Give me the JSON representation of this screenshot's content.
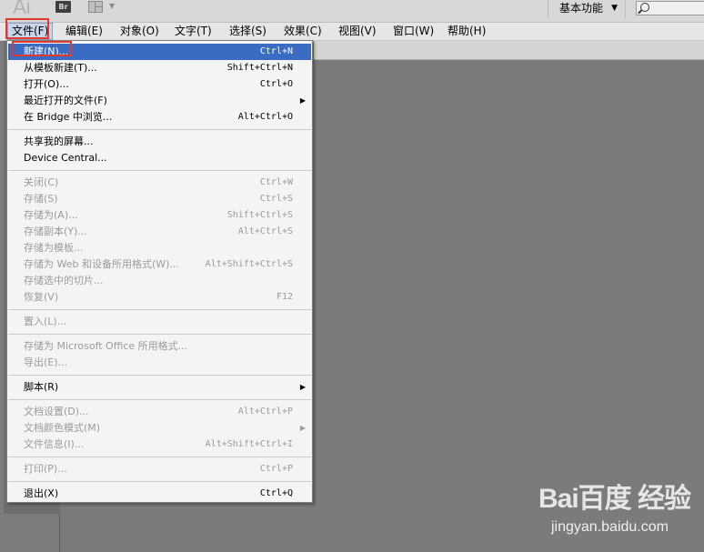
{
  "app": {
    "logo_text": "Ai",
    "bridge_badge": "Br",
    "workspace_label": "基本功能"
  },
  "menubar": [
    {
      "label": "文件(F)",
      "active": true
    },
    {
      "label": "编辑(E)"
    },
    {
      "label": "对象(O)"
    },
    {
      "label": "文字(T)"
    },
    {
      "label": "选择(S)"
    },
    {
      "label": "效果(C)"
    },
    {
      "label": "视图(V)"
    },
    {
      "label": "窗口(W)"
    },
    {
      "label": "帮助(H)"
    }
  ],
  "file_menu": [
    {
      "label": "新建(N)...",
      "shortcut": "Ctrl+N",
      "highlight": true
    },
    {
      "label": "从模板新建(T)...",
      "shortcut": "Shift+Ctrl+N"
    },
    {
      "label": "打开(O)...",
      "shortcut": "Ctrl+O"
    },
    {
      "label": "最近打开的文件(F)",
      "submenu": true
    },
    {
      "label": "在 Bridge 中浏览...",
      "shortcut": "Alt+Ctrl+O"
    },
    {
      "separator": true
    },
    {
      "label": "共享我的屏幕..."
    },
    {
      "label": "Device Central..."
    },
    {
      "separator": true
    },
    {
      "label": "关闭(C)",
      "shortcut": "Ctrl+W",
      "disabled": true
    },
    {
      "label": "存储(S)",
      "shortcut": "Ctrl+S",
      "disabled": true
    },
    {
      "label": "存储为(A)...",
      "shortcut": "Shift+Ctrl+S",
      "disabled": true
    },
    {
      "label": "存储副本(Y)...",
      "shortcut": "Alt+Ctrl+S",
      "disabled": true
    },
    {
      "label": "存储为模板...",
      "disabled": true
    },
    {
      "label": "存储为 Web 和设备所用格式(W)...",
      "shortcut": "Alt+Shift+Ctrl+S",
      "disabled": true
    },
    {
      "label": "存储选中的切片...",
      "disabled": true
    },
    {
      "label": "恢复(V)",
      "shortcut": "F12",
      "disabled": true
    },
    {
      "separator": true
    },
    {
      "label": "置入(L)...",
      "disabled": true
    },
    {
      "separator": true
    },
    {
      "label": "存储为 Microsoft Office 所用格式...",
      "disabled": true
    },
    {
      "label": "导出(E)...",
      "disabled": true
    },
    {
      "separator": true
    },
    {
      "label": "脚本(R)",
      "submenu": true
    },
    {
      "separator": true
    },
    {
      "label": "文档设置(D)...",
      "shortcut": "Alt+Ctrl+P",
      "disabled": true
    },
    {
      "label": "文档颜色模式(M)",
      "submenu": true,
      "disabled": true
    },
    {
      "label": "文件信息(I)...",
      "shortcut": "Alt+Shift+Ctrl+I",
      "disabled": true
    },
    {
      "separator": true
    },
    {
      "label": "打印(P)...",
      "shortcut": "Ctrl+P",
      "disabled": true
    },
    {
      "separator": true
    },
    {
      "label": "退出(X)",
      "shortcut": "Ctrl+Q"
    }
  ],
  "watermark": {
    "logo": "Bai百度 经验",
    "url": "jingyan.baidu.com"
  },
  "colors": {
    "highlight": "#3a6cc4",
    "annotation_red": "#e23a2e",
    "background": "#7a7a7a"
  }
}
